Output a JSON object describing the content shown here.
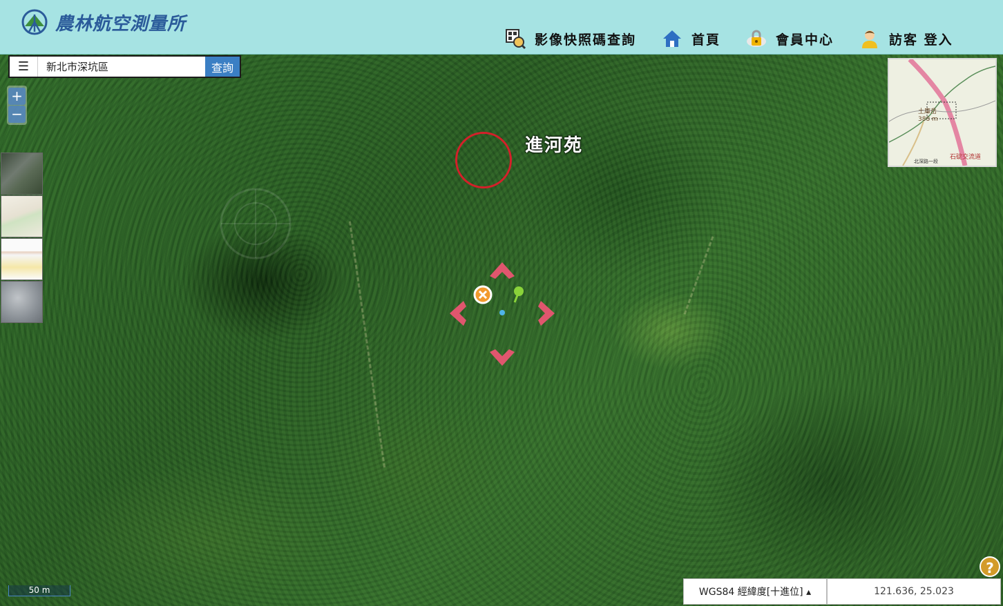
{
  "header": {
    "title": "農林航空測量所",
    "nav": [
      {
        "label": "影像快照碼查詢",
        "icon": "qr-search-icon"
      },
      {
        "label": "首頁",
        "icon": "home-icon"
      },
      {
        "label": "會員中心",
        "icon": "lock-cloud-icon"
      },
      {
        "label": "訪客 登入",
        "icon": "user-icon"
      }
    ]
  },
  "search": {
    "value": "新北市深坑區",
    "button": "查詢"
  },
  "zoom": {
    "in": "+",
    "out": "−"
  },
  "annotation": {
    "label": "進河苑"
  },
  "minimap": {
    "labels": [
      "土庫岳",
      "388 m",
      "石碇交流道",
      "北深路一段"
    ]
  },
  "scale": {
    "label": "50 m"
  },
  "coordinates": {
    "system": "WGS84 經緯度[十進位] ▴",
    "value": "121.636, 25.023"
  },
  "help": {
    "label": "?"
  },
  "colors": {
    "header_bg": "#a6e3e3",
    "accent_blue": "#3b7fc4",
    "marker_red": "#d4202a",
    "nav_arrow": "#e0566e"
  }
}
